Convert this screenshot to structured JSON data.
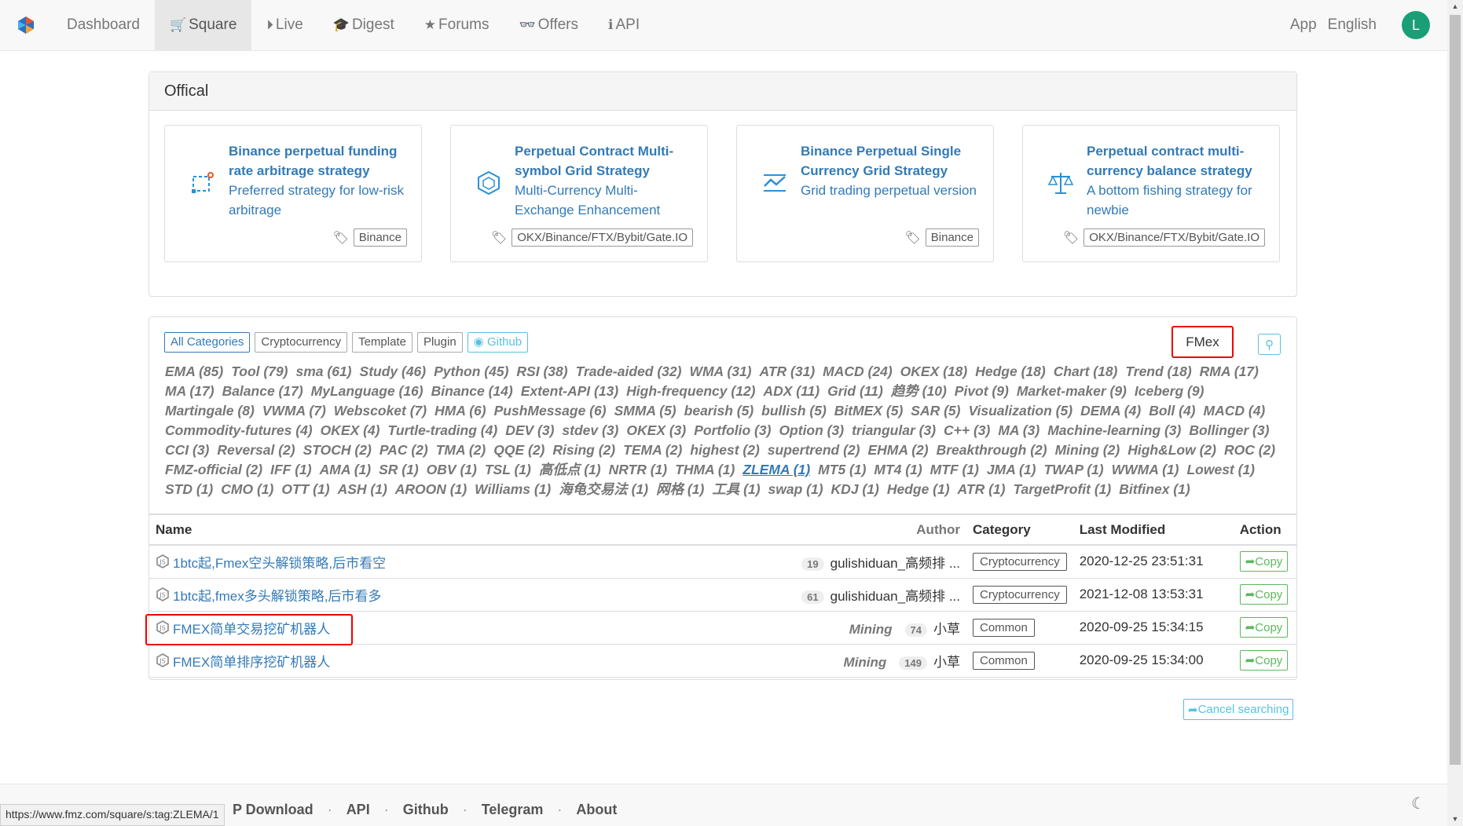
{
  "nav": {
    "items": [
      {
        "label": "Dashboard",
        "icon": ""
      },
      {
        "label": "Square",
        "icon": "🛒"
      },
      {
        "label": "Live",
        "icon": "⏵"
      },
      {
        "label": "Digest",
        "icon": "🎓"
      },
      {
        "label": "Forums",
        "icon": "★"
      },
      {
        "label": "Offers",
        "icon": "👓"
      },
      {
        "label": "API",
        "icon": "ℹ"
      }
    ],
    "app": "App",
    "language": "English",
    "avatar": "L"
  },
  "official": {
    "heading": "Offical",
    "cards": [
      {
        "title": "Binance perpetual funding rate arbitrage strategy",
        "desc": "Preferred strategy for low-risk arbitrage",
        "tag": "Binance"
      },
      {
        "title": "Perpetual Contract Multi-symbol Grid Strategy",
        "desc": "Multi-Currency Multi-Exchange Enhancement",
        "tag": "OKX/Binance/FTX/Bybit/Gate.IO"
      },
      {
        "title": "Binance Perpetual Single Currency Grid Strategy",
        "desc": "Grid trading perpetual version",
        "tag": "Binance"
      },
      {
        "title": "Perpetual contract multi-currency balance strategy",
        "desc": "A bottom fishing strategy for newbie",
        "tag": "OKX/Binance/FTX/Bybit/Gate.IO"
      }
    ]
  },
  "filters": [
    "All Categories",
    "Cryptocurrency",
    "Template",
    "Plugin",
    "Github"
  ],
  "search": {
    "value": "FMex"
  },
  "tags": [
    "EMA (85)",
    "Tool (79)",
    "sma (61)",
    "Study (46)",
    "Python (45)",
    "RSI (38)",
    "Trade-aided (32)",
    "WMA (31)",
    "ATR (31)",
    "MACD (24)",
    "OKEX (18)",
    "Hedge (18)",
    "Chart (18)",
    "Trend (18)",
    "RMA (17)",
    "MA (17)",
    "Balance (17)",
    "MyLanguage (16)",
    "Binance (14)",
    "Extent-API (13)",
    "High-frequency (12)",
    "ADX (11)",
    "Grid (11)",
    "趋势 (10)",
    "Pivot (9)",
    "Market-maker (9)",
    "Iceberg (9)",
    "Martingale (8)",
    "VWMA (7)",
    "Webscoket (7)",
    "HMA (6)",
    "PushMessage (6)",
    "SMMA (5)",
    "bearish (5)",
    "bullish (5)",
    "BitMEX (5)",
    "SAR (5)",
    "Visualization (5)",
    "DEMA (4)",
    "Boll (4)",
    "MACD (4)",
    "Commodity-futures (4)",
    "OKEX (4)",
    "Turtle-trading (4)",
    "DEV (3)",
    "stdev (3)",
    "OKEX (3)",
    "Portfolio (3)",
    "Option (3)",
    "triangular (3)",
    "C++ (3)",
    "MA (3)",
    "Machine-learning (3)",
    "Bollinger (3)",
    "CCI (3)",
    "Reversal (2)",
    "STOCH (2)",
    "PAC (2)",
    "TMA (2)",
    "QQE (2)",
    "Rising (2)",
    "TEMA (2)",
    "highest (2)",
    "supertrend (2)",
    "EHMA (2)",
    "Breakthrough (2)",
    "Mining (2)",
    "High&Low (2)",
    "ROC (2)",
    "FMZ-official (2)",
    "IFF (1)",
    "AMA (1)",
    "SR (1)",
    "OBV (1)",
    "TSL (1)",
    "高低点 (1)",
    "NRTR (1)",
    "THMA (1)",
    "ZLEMA (1)",
    "MT5 (1)",
    "MT4 (1)",
    "MTF (1)",
    "JMA (1)",
    "TWAP (1)",
    "WWMA (1)",
    "Lowest (1)",
    "STD (1)",
    "CMO (1)",
    "OTT (1)",
    "ASH (1)",
    "AROON (1)",
    "Williams (1)",
    "海龟交易法 (1)",
    "网格 (1)",
    "工具 (1)",
    "swap (1)",
    "KDJ (1)",
    "Hedge (1)",
    "ATR (1)",
    "TargetProfit (1)",
    "Bitfinex (1)"
  ],
  "selected_tag": "ZLEMA (1)",
  "table": {
    "headers": {
      "name": "Name",
      "author": "Author",
      "category": "Category",
      "modified": "Last Modified",
      "action": "Action"
    },
    "rows": [
      {
        "name": "1btc起,Fmex空头解锁策略,后市看空",
        "tag": "",
        "badge": "19",
        "author": "gulishiduan_高频排 ...",
        "category": "Cryptocurrency",
        "modified": "2020-12-25 23:51:31",
        "action": "Copy"
      },
      {
        "name": "1btc起,fmex多头解锁策略,后市看多",
        "tag": "",
        "badge": "61",
        "author": "gulishiduan_高频排 ...",
        "category": "Cryptocurrency",
        "modified": "2021-12-08 13:53:31",
        "action": "Copy"
      },
      {
        "name": "FMEX简单交易挖矿机器人",
        "tag": "Mining",
        "badge": "74",
        "author": "小草",
        "category": "Common",
        "modified": "2020-09-25 15:34:15",
        "action": "Copy"
      },
      {
        "name": "FMEX简单排序挖矿机器人",
        "tag": "Mining",
        "badge": "149",
        "author": "小草",
        "category": "Common",
        "modified": "2020-09-25 15:34:00",
        "action": "Copy"
      }
    ]
  },
  "cancel_search": "Cancel searching",
  "footer": {
    "links": [
      "P Download",
      "API",
      "Github",
      "Telegram",
      "About"
    ]
  },
  "status_url": "https://www.fmz.com/square/s:tag:ZLEMA/1",
  "colors": {
    "link": "#337ab7",
    "highlight": "#ee0000",
    "copy": "#5cb85c",
    "info": "#5bc0de",
    "avatar": "#1a9e76"
  }
}
